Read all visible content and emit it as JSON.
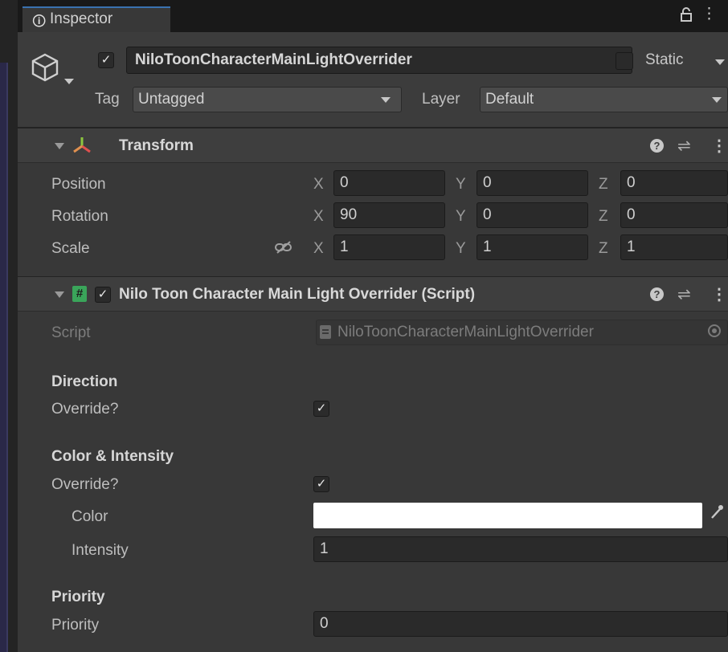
{
  "tab": {
    "label": "Inspector",
    "icon": "info-icon"
  },
  "header": {
    "enabled_checked": true,
    "object_name": "NiloToonCharacterMainLightOverrider",
    "static_label": "Static",
    "static_checked": false,
    "tag_label": "Tag",
    "tag_value": "Untagged",
    "layer_label": "Layer",
    "layer_value": "Default"
  },
  "transform": {
    "title": "Transform",
    "rows": [
      {
        "label": "Position",
        "x": "0",
        "y": "0",
        "z": "0"
      },
      {
        "label": "Rotation",
        "x": "90",
        "y": "0",
        "z": "0"
      },
      {
        "label": "Scale",
        "x": "1",
        "y": "1",
        "z": "1"
      }
    ],
    "axes": {
      "x": "X",
      "y": "Y",
      "z": "Z"
    }
  },
  "script_component": {
    "title": "Nilo Toon Character Main Light Overrider (Script)",
    "enabled_checked": true,
    "script_label": "Script",
    "script_value": "NiloToonCharacterMainLightOverrider",
    "direction": {
      "header": "Direction",
      "override_label": "Override?",
      "override_checked": true
    },
    "color_intensity": {
      "header": "Color & Intensity",
      "override_label": "Override?",
      "override_checked": true,
      "color_label": "Color",
      "color_value": "#ffffff",
      "intensity_label": "Intensity",
      "intensity_value": "1"
    },
    "priority": {
      "header": "Priority",
      "priority_label": "Priority",
      "priority_value": "0"
    }
  },
  "colors": {
    "panel_bg": "#383838",
    "field_bg": "#2a2a2a",
    "accent": "#3a72b0",
    "transform_icon_x": "#e0504f",
    "transform_icon_y": "#8cc63f",
    "transform_icon_z": "#3f8ee8",
    "script_icon": "#3aa55a"
  }
}
